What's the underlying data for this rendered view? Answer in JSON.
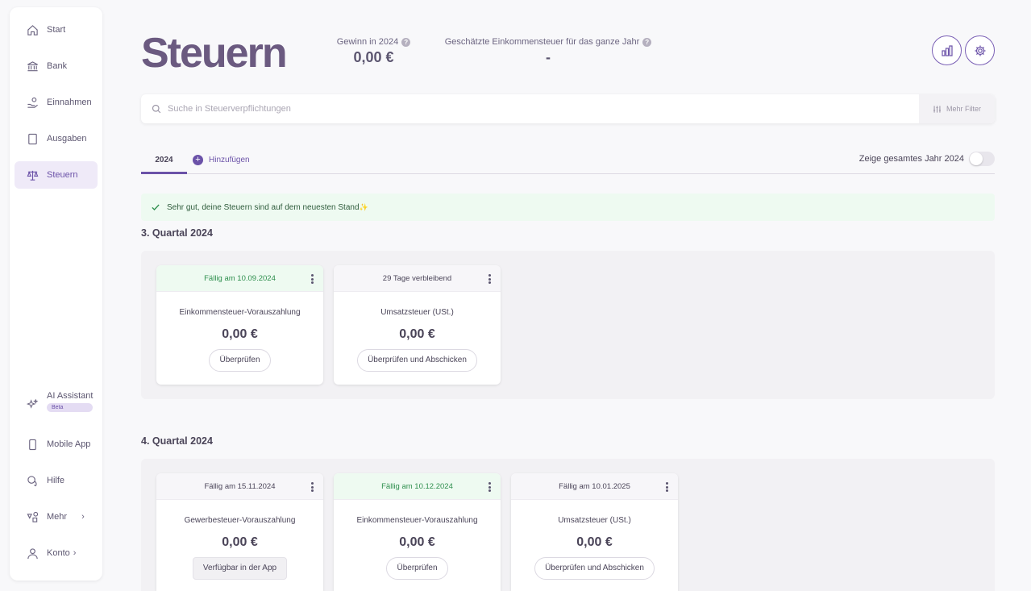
{
  "sidebar": {
    "items": [
      {
        "label": "Start",
        "icon": "home-icon"
      },
      {
        "label": "Bank",
        "icon": "bank-icon"
      },
      {
        "label": "Einnahmen",
        "icon": "income-icon"
      },
      {
        "label": "Ausgaben",
        "icon": "receipt-icon"
      },
      {
        "label": "Steuern",
        "icon": "scale-icon",
        "active": true
      }
    ],
    "bottom": [
      {
        "label": "AI Assistant",
        "badge": "Beta",
        "icon": "sparkle-icon"
      },
      {
        "label": "Mobile App",
        "icon": "phone-icon"
      },
      {
        "label": "Hilfe",
        "icon": "chat-icon"
      },
      {
        "label": "Mehr",
        "icon": "shapes-icon"
      },
      {
        "label": "Konto",
        "icon": "user-icon"
      }
    ]
  },
  "header": {
    "title": "Steuern",
    "profit_label": "Gewinn in 2024",
    "profit_value": "0,00 €",
    "tax_label": "Geschätzte Einkommensteuer für das ganze Jahr",
    "tax_value": "-"
  },
  "search": {
    "placeholder": "Suche in Steuerverpflichtungen",
    "filter_label": "Mehr Filter"
  },
  "tabs": {
    "year": "2024",
    "add_label": "Hinzufügen",
    "toggle_label": "Zeige gesamtes Jahr 2024"
  },
  "banner": {
    "text": "Sehr gut, deine Steuern sind auf dem neuesten Stand",
    "emoji": "✨"
  },
  "sections": [
    {
      "title": "3. Quartal 2024",
      "cards": [
        {
          "head": "Fällig am 10.09.2024",
          "name": "Einkommensteuer-Vorauszahlung",
          "amount": "0,00 €",
          "button": "Überprüfen"
        },
        {
          "head": "29 Tage verbleibend",
          "name": "Umsatzsteuer (USt.)",
          "amount": "0,00 €",
          "button": "Überprüfen und Abschicken"
        }
      ]
    },
    {
      "title": "4. Quartal 2024",
      "cards": [
        {
          "head": "Fällig am 15.11.2024",
          "name": "Gewerbesteuer-Vorauszahlung",
          "amount": "0,00 €",
          "button": "Verfügbar in der App"
        },
        {
          "head": "Fällig am 10.12.2024",
          "name": "Einkommensteuer-Vorauszahlung",
          "amount": "0,00 €",
          "button": "Überprüfen"
        },
        {
          "head": "Fällig am 10.01.2025",
          "name": "Umsatzsteuer (USt.)",
          "amount": "0,00 €",
          "button": "Überprüfen und Abschicken"
        }
      ]
    }
  ],
  "colors": {
    "accent": "#6b52a8",
    "success_bg": "#eefaf1",
    "success_text": "#2f8f4e"
  }
}
